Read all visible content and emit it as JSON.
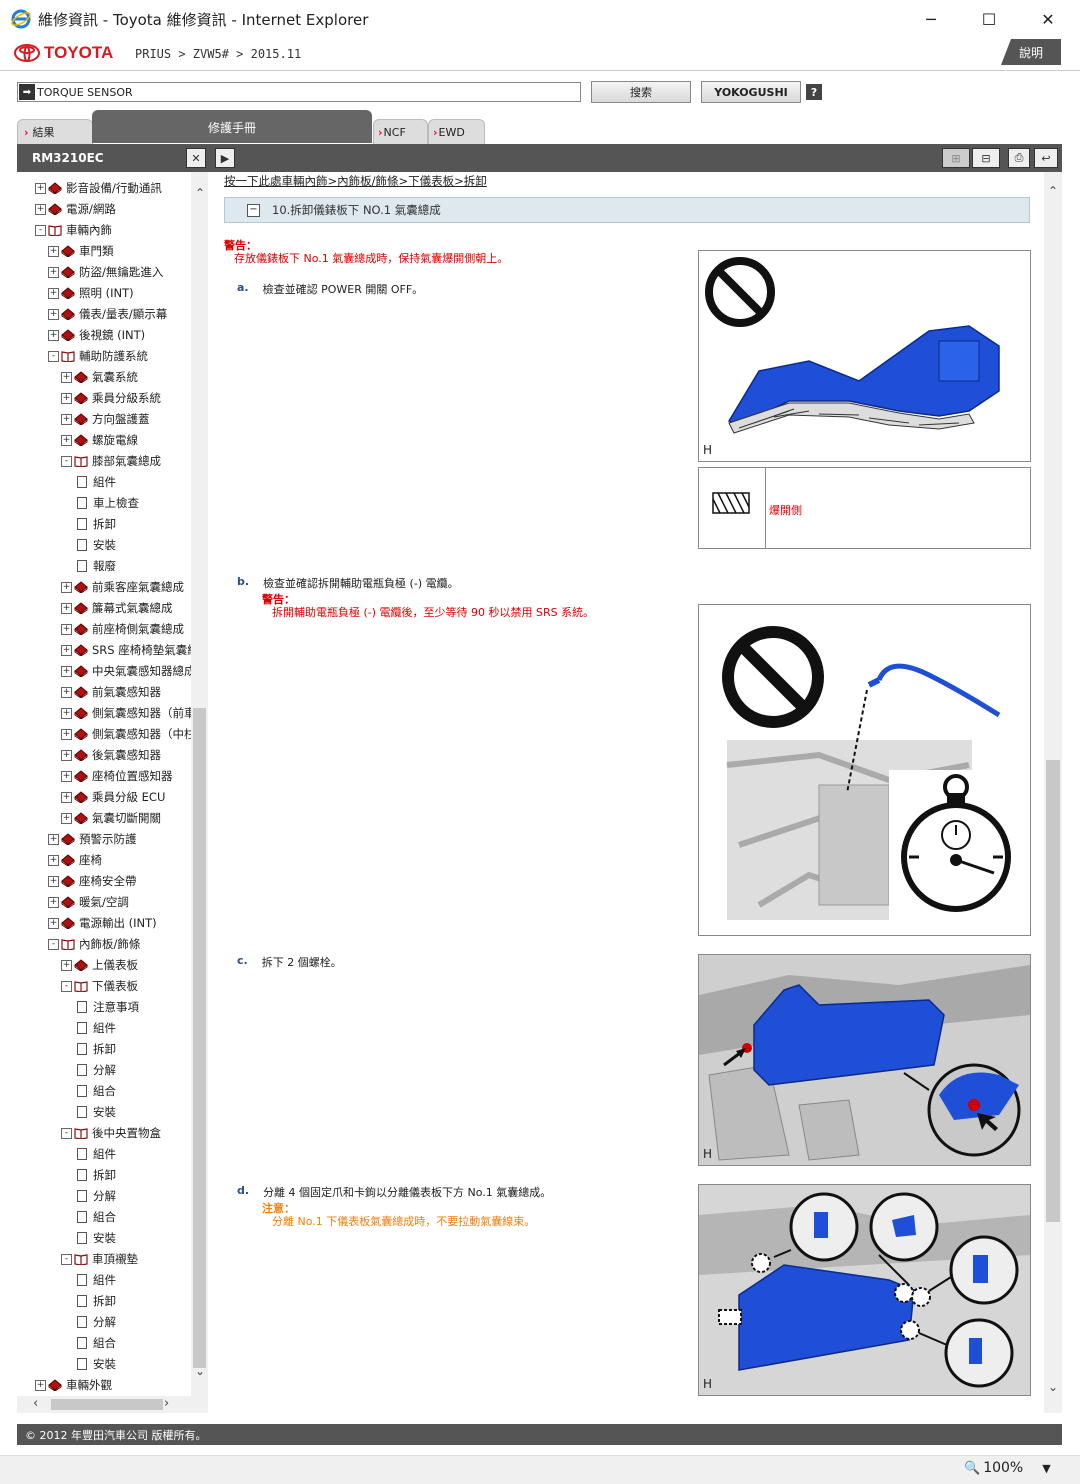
{
  "window": {
    "title": "維修資訊 - Toyota 維修資訊 - Internet Explorer",
    "minimize": "─",
    "maximize": "☐",
    "close": "✕"
  },
  "header": {
    "brand": "TOYOTA",
    "breadcrumb": "PRIUS > ZVW5# > 2015.11",
    "help_label": "說明"
  },
  "search": {
    "value": "TORQUE SENSOR",
    "search_button": "搜索",
    "yokogushi_button": "YOKOGUSHI",
    "question_button": "?"
  },
  "tabs": {
    "results": "結果",
    "manual": "修護手冊",
    "ncf": "NCF",
    "ewd": "EWD"
  },
  "toolbar": {
    "doc_id": "RM3210EC",
    "close_btn": "✕",
    "play_btn": "▶",
    "expand_btn": "⊞",
    "collapse_btn": "⊟",
    "print_btn": "⎙",
    "back_btn": "↩"
  },
  "tree": [
    {
      "level": 0,
      "type": "book",
      "sign": "+",
      "label": "影音設備/行動通訊"
    },
    {
      "level": 0,
      "type": "book",
      "sign": "+",
      "label": "電源/網路"
    },
    {
      "level": 0,
      "type": "open",
      "sign": "-",
      "label": "車輛內飾"
    },
    {
      "level": 1,
      "type": "book",
      "sign": "+",
      "label": "車門類"
    },
    {
      "level": 1,
      "type": "book",
      "sign": "+",
      "label": "防盜/無鑰匙進入"
    },
    {
      "level": 1,
      "type": "book",
      "sign": "+",
      "label": "照明 (INT)"
    },
    {
      "level": 1,
      "type": "book",
      "sign": "+",
      "label": "儀表/量表/顯示幕"
    },
    {
      "level": 1,
      "type": "book",
      "sign": "+",
      "label": "後視鏡 (INT)"
    },
    {
      "level": 1,
      "type": "open",
      "sign": "-",
      "label": "輔助防護系統"
    },
    {
      "level": 2,
      "type": "book",
      "sign": "+",
      "label": "氣囊系統"
    },
    {
      "level": 2,
      "type": "book",
      "sign": "+",
      "label": "乘員分級系統"
    },
    {
      "level": 2,
      "type": "book",
      "sign": "+",
      "label": "方向盤護蓋"
    },
    {
      "level": 2,
      "type": "book",
      "sign": "+",
      "label": "螺旋電線"
    },
    {
      "level": 2,
      "type": "open",
      "sign": "-",
      "label": "膝部氣囊總成"
    },
    {
      "level": 3,
      "type": "page",
      "label": "組件"
    },
    {
      "level": 3,
      "type": "page",
      "label": "車上檢查"
    },
    {
      "level": 3,
      "type": "page",
      "label": "拆卸"
    },
    {
      "level": 3,
      "type": "page",
      "label": "安裝"
    },
    {
      "level": 3,
      "type": "page",
      "label": "報廢"
    },
    {
      "level": 2,
      "type": "book",
      "sign": "+",
      "label": "前乘客座氣囊總成"
    },
    {
      "level": 2,
      "type": "book",
      "sign": "+",
      "label": "簾幕式氣囊總成"
    },
    {
      "level": 2,
      "type": "book",
      "sign": "+",
      "label": "前座椅側氣囊總成"
    },
    {
      "level": 2,
      "type": "book",
      "sign": "+",
      "label": "SRS 座椅椅墊氣囊總成"
    },
    {
      "level": 2,
      "type": "book",
      "sign": "+",
      "label": "中央氣囊感知器總成"
    },
    {
      "level": 2,
      "type": "book",
      "sign": "+",
      "label": "前氣囊感知器"
    },
    {
      "level": 2,
      "type": "book",
      "sign": "+",
      "label": "側氣囊感知器（前車門）"
    },
    {
      "level": 2,
      "type": "book",
      "sign": "+",
      "label": "側氣囊感知器（中柱）"
    },
    {
      "level": 2,
      "type": "book",
      "sign": "+",
      "label": "後氣囊感知器"
    },
    {
      "level": 2,
      "type": "book",
      "sign": "+",
      "label": "座椅位置感知器"
    },
    {
      "level": 2,
      "type": "book",
      "sign": "+",
      "label": "乘員分級 ECU"
    },
    {
      "level": 2,
      "type": "book",
      "sign": "+",
      "label": "氣囊切斷開關"
    },
    {
      "level": 1,
      "type": "book",
      "sign": "+",
      "label": "預警示防護"
    },
    {
      "level": 1,
      "type": "book",
      "sign": "+",
      "label": "座椅"
    },
    {
      "level": 1,
      "type": "book",
      "sign": "+",
      "label": "座椅安全帶"
    },
    {
      "level": 1,
      "type": "book",
      "sign": "+",
      "label": "暖氣/空調"
    },
    {
      "level": 1,
      "type": "book",
      "sign": "+",
      "label": "電源輸出 (INT)"
    },
    {
      "level": 1,
      "type": "open",
      "sign": "-",
      "label": "內飾板/飾條"
    },
    {
      "level": 2,
      "type": "book",
      "sign": "+",
      "label": "上儀表板"
    },
    {
      "level": 2,
      "type": "open",
      "sign": "-",
      "label": "下儀表板"
    },
    {
      "level": 3,
      "type": "page",
      "label": "注意事項"
    },
    {
      "level": 3,
      "type": "page",
      "label": "組件"
    },
    {
      "level": 3,
      "type": "page",
      "label": "拆卸"
    },
    {
      "level": 3,
      "type": "page",
      "label": "分解"
    },
    {
      "level": 3,
      "type": "page",
      "label": "組合"
    },
    {
      "level": 3,
      "type": "page",
      "label": "安裝"
    },
    {
      "level": 2,
      "type": "open",
      "sign": "-",
      "label": "後中央置物盒"
    },
    {
      "level": 3,
      "type": "page",
      "label": "組件"
    },
    {
      "level": 3,
      "type": "page",
      "label": "拆卸"
    },
    {
      "level": 3,
      "type": "page",
      "label": "分解"
    },
    {
      "level": 3,
      "type": "page",
      "label": "組合"
    },
    {
      "level": 3,
      "type": "page",
      "label": "安裝"
    },
    {
      "level": 2,
      "type": "open",
      "sign": "-",
      "label": "車頂襯墊"
    },
    {
      "level": 3,
      "type": "page",
      "label": "組件"
    },
    {
      "level": 3,
      "type": "page",
      "label": "拆卸"
    },
    {
      "level": 3,
      "type": "page",
      "label": "分解"
    },
    {
      "level": 3,
      "type": "page",
      "label": "組合"
    },
    {
      "level": 3,
      "type": "page",
      "label": "安裝"
    },
    {
      "level": 0,
      "type": "book",
      "sign": "+",
      "label": "車輛外觀"
    }
  ],
  "content": {
    "nav_path": "按一下此處車輛內飾>內飾板/飾條>下儀表板>拆卸",
    "section_toggle": "−",
    "section_title": "10.拆卸儀錶板下 NO.1 氣囊總成",
    "warning_label": "警告：",
    "warning_text": "存放儀錶板下 No.1 氣囊總成時，保持氣囊爆開側朝上。",
    "steps": {
      "a": {
        "marker": "a.",
        "text": "檢查並確認 POWER 開關 OFF。"
      },
      "b": {
        "marker": "b.",
        "text": "檢查並確認拆開輔助電瓶負極 (-) 電纜。",
        "note_label": "警告：",
        "note_text": "拆開輔助電瓶負極 (-) 電纜後，至少等待 90 秒以禁用 SRS 系統。"
      },
      "c": {
        "marker": "c.",
        "text": "拆下 2 個螺栓。"
      },
      "d": {
        "marker": "d.",
        "text": "分離 4 個固定爪和卡鉤以分離儀表板下方 No.1 氣囊總成。",
        "note_label": "注意：",
        "note_text": "分離 No.1 下儀表板氣囊總成時，不要拉動氣囊線束。"
      }
    },
    "image_letter": "H",
    "legend_label": "爆開側"
  },
  "footer": {
    "copyright": "© 2012 年豐田汽車公司 版權所有。"
  },
  "status": {
    "zoom": "100%",
    "zoom_icon": "magnifier-icon"
  },
  "colors": {
    "brand_red": "#d71920",
    "warning_red": "#e00000",
    "caution_orange": "#f08010",
    "part_blue": "#1f4fd6"
  }
}
